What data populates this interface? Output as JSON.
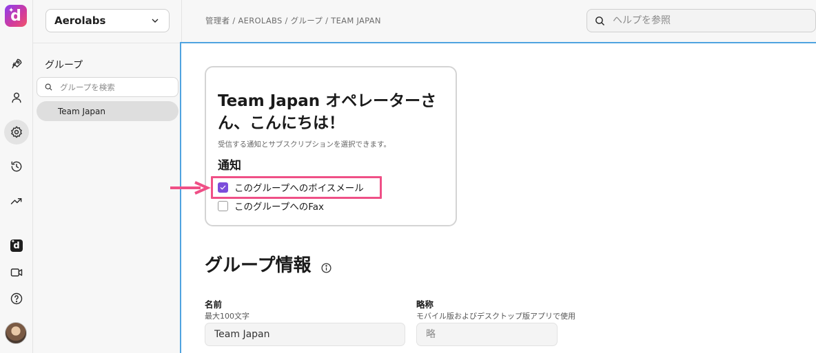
{
  "rail": {
    "logo_letter": "d",
    "items": [
      {
        "icon": "rocket-icon"
      },
      {
        "icon": "user-icon"
      },
      {
        "icon": "gear-icon"
      },
      {
        "icon": "history-icon"
      },
      {
        "icon": "trending-icon"
      },
      {
        "icon": "d-app-icon",
        "letter": "d"
      },
      {
        "icon": "video-icon"
      },
      {
        "icon": "help-icon"
      }
    ],
    "active": "gear-icon"
  },
  "panel": {
    "org_name": "Aerolabs",
    "title": "グループ",
    "search_placeholder": "グループを検索",
    "groups": [
      "Team Japan"
    ]
  },
  "topbar": {
    "breadcrumb": "管理者 / AEROLABS / グループ / TEAM JAPAN",
    "help_placeholder": "ヘルプを参照"
  },
  "card": {
    "title": "Team Japan オペレーターさん、こんにちは！",
    "subtitle": "受信する通知とサブスクリプションを選択できます。",
    "section": "通知",
    "options": [
      {
        "label": "このグループへのボイスメール",
        "checked": true
      },
      {
        "label": "このグループへのFax",
        "checked": false
      }
    ]
  },
  "group_info": {
    "title": "グループ情報",
    "name_label": "名前",
    "name_help": "最大100文字",
    "name_value": "Team Japan",
    "short_label": "略称",
    "short_help": "モバイル版およびデスクトップ版アプリで使用",
    "short_placeholder": "略"
  },
  "colors": {
    "accent": "#7c4ddb",
    "highlight": "#ef4f86",
    "focus_border": "#4fa3e0"
  }
}
